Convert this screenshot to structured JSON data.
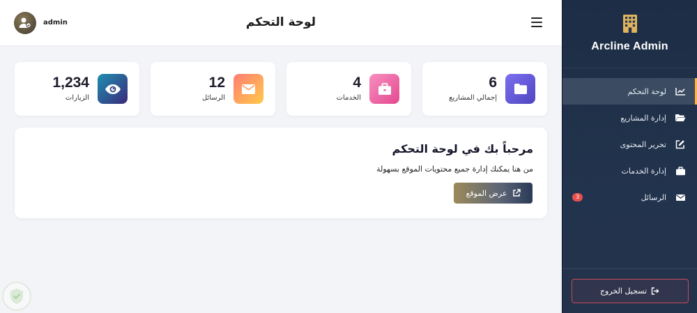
{
  "sidebar": {
    "brand": {
      "name": "Arcline Admin",
      "icon": "building-icon"
    },
    "items": [
      {
        "label": "لوحة التحكم",
        "icon": "chart-line-icon",
        "active": true
      },
      {
        "label": "إدارة المشاريع",
        "icon": "folder-open-icon"
      },
      {
        "label": "تحرير المحتوى",
        "icon": "edit-icon"
      },
      {
        "label": "إدارة الخدمات",
        "icon": "briefcase-icon"
      },
      {
        "label": "الرسائل",
        "icon": "envelope-icon",
        "badge": "3"
      }
    ],
    "logout_label": "تسجيل الخروج",
    "active_accent": "#ffb347"
  },
  "topbar": {
    "title": "لوحة التحكم",
    "user_name": "admin"
  },
  "stats": [
    {
      "value": "6",
      "label": "إجمالي المشاريع",
      "icon": "folder-icon",
      "color": "#6a5fd8"
    },
    {
      "value": "4",
      "label": "الخدمات",
      "icon": "briefcase-icon",
      "color": "#f06aa8"
    },
    {
      "value": "12",
      "label": "الرسائل",
      "icon": "envelope-icon",
      "color": "#ff8e6e"
    },
    {
      "value": "1,234",
      "label": "الزيارات",
      "icon": "eye-icon",
      "color": "#2a3b7c"
    }
  ],
  "welcome": {
    "title": "مرحباً بك في لوحة التحكم",
    "text": "من هنا يمكنك إدارة جميع محتويات الموقع بسهولة",
    "button_label": "عرض الموقع"
  }
}
